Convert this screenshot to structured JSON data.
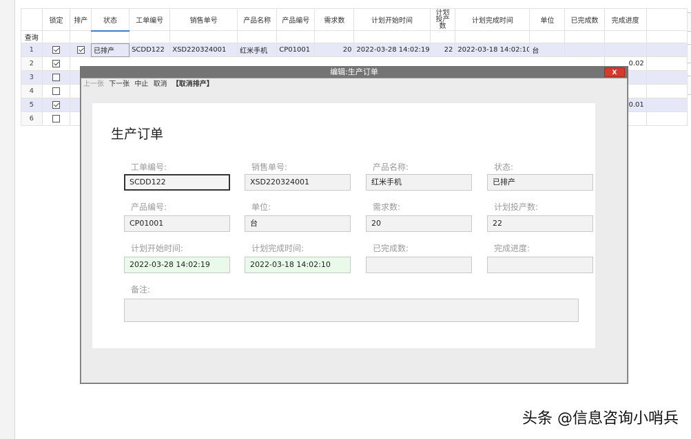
{
  "columns": [
    "锁定",
    "排产",
    "状态",
    "工单编号",
    "销售单号",
    "产品名称",
    "产品编号",
    "需求数",
    "计划开始时间",
    "计划投产数",
    "计划完成时间",
    "单位",
    "已完成数",
    "完成进度"
  ],
  "query_label": "查询",
  "rows": [
    {
      "rn": "1",
      "locked": true,
      "scheduled": true,
      "status": "已排产",
      "wo": "SCDD122",
      "so": "XSD220324001",
      "pname": "红米手机",
      "pcode": "CP01001",
      "demand": "20",
      "start": "2022-03-28 14:02:19",
      "qty": "22",
      "end": "2022-03-18 14:02:10",
      "unit": "台",
      "done": "",
      "progress": ""
    },
    {
      "rn": "2",
      "locked": true,
      "progress": "0.02"
    },
    {
      "rn": "3",
      "locked": false,
      "progress": ""
    },
    {
      "rn": "4",
      "locked": false,
      "progress": ""
    },
    {
      "rn": "5",
      "locked": true,
      "progress": "0.01"
    },
    {
      "rn": "6",
      "locked": false,
      "progress": ""
    }
  ],
  "modal": {
    "title": "编辑:生产订单",
    "close": "X",
    "toolbar": {
      "prev": "上一张",
      "next": "下一张",
      "abort": "中止",
      "cancel": "取消",
      "unschedule": "【取消排产】"
    },
    "heading": "生产订单",
    "fields": {
      "wo_label": "工单编号:",
      "wo": "SCDD122",
      "so_label": "销售单号:",
      "so": "XSD220324001",
      "pname_label": "产品名称:",
      "pname": "红米手机",
      "status_label": "状态:",
      "status": "已排产",
      "pcode_label": "产品编号:",
      "pcode": "CP01001",
      "unit_label": "单位:",
      "unit": "台",
      "demand_label": "需求数:",
      "demand": "20",
      "qty_label": "计划投产数:",
      "qty": "22",
      "start_label": "计划开始时间:",
      "start": "2022-03-28 14:02:19",
      "end_label": "计划完成时间:",
      "end": "2022-03-18 14:02:10",
      "done_label": "已完成数:",
      "done": "",
      "progress_label": "完成进度:",
      "progress": "",
      "remark_label": "备注:"
    }
  },
  "watermark": "头条 @信息咨询小哨兵"
}
